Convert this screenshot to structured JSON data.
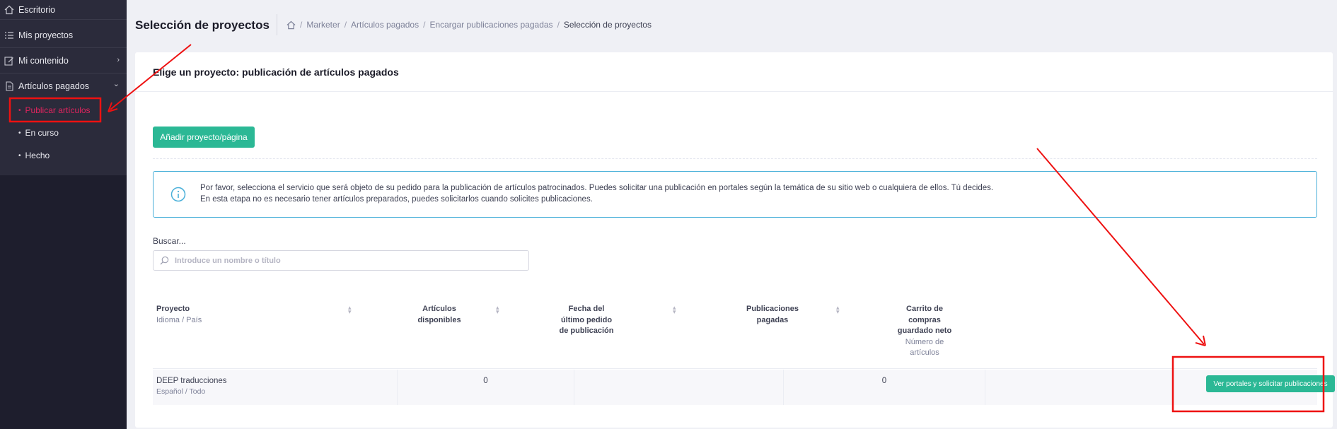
{
  "sidebar": {
    "items": [
      {
        "label": "Escritorio",
        "icon": "home-icon"
      },
      {
        "label": "Mis proyectos",
        "icon": "list-icon"
      },
      {
        "label": "Mi contenido",
        "icon": "edit-icon",
        "chevron": "›"
      },
      {
        "label": "Artículos pagados",
        "icon": "document-icon",
        "chevron": "⌄"
      }
    ],
    "sub_items": [
      {
        "label": "Publicar artículos",
        "active": true
      },
      {
        "label": "En curso",
        "active": false
      },
      {
        "label": "Hecho",
        "active": false
      }
    ]
  },
  "header": {
    "title": "Selección de proyectos",
    "breadcrumb": [
      "Marketer",
      "Artículos pagados",
      "Encargar publicaciones pagadas",
      "Selección de proyectos"
    ],
    "separator": "/"
  },
  "card": {
    "title": "Elige un proyecto: publicación de artículos pagados",
    "add_button": "Añadir proyecto/página",
    "info_line1": "Por favor, selecciona el servicio que será objeto de su pedido para la publicación de artículos patrocinados. Puedes solicitar una publicación en portales según la temática de su sitio web o cualquiera de ellos. Tú decides.",
    "info_line2": "En esta etapa no es necesario tener artículos preparados, puedes solicitarlos cuando solicites publicaciones.",
    "search_label": "Buscar...",
    "search_placeholder": "Introduce un nombre o título"
  },
  "table": {
    "columns": [
      {
        "main": [
          "Proyecto"
        ],
        "sub": [
          "Idioma / País"
        ]
      },
      {
        "main": [
          "Artículos",
          "disponibles"
        ],
        "sub": []
      },
      {
        "main": [
          "Fecha del",
          "último pedido",
          "de publicación"
        ],
        "sub": []
      },
      {
        "main": [
          "Publicaciones",
          "pagadas"
        ],
        "sub": []
      },
      {
        "main": [
          "Carrito de",
          "compras",
          "guardado neto"
        ],
        "sub": [
          "Número de",
          "artículos"
        ]
      }
    ],
    "rows": [
      {
        "project": "DEEP traducciones",
        "language": "Español / Todo",
        "articles_available": "0",
        "last_order_date": "",
        "paid_publications": "0",
        "cart": "",
        "action": "Ver portales y solicitar publicaciones"
      }
    ]
  },
  "colors": {
    "accent": "#2bb895",
    "sidebar_bg": "#1e1e2d",
    "active_link": "#e0245e",
    "annotation": "#ee1111",
    "info_border": "#4ab0d9"
  }
}
